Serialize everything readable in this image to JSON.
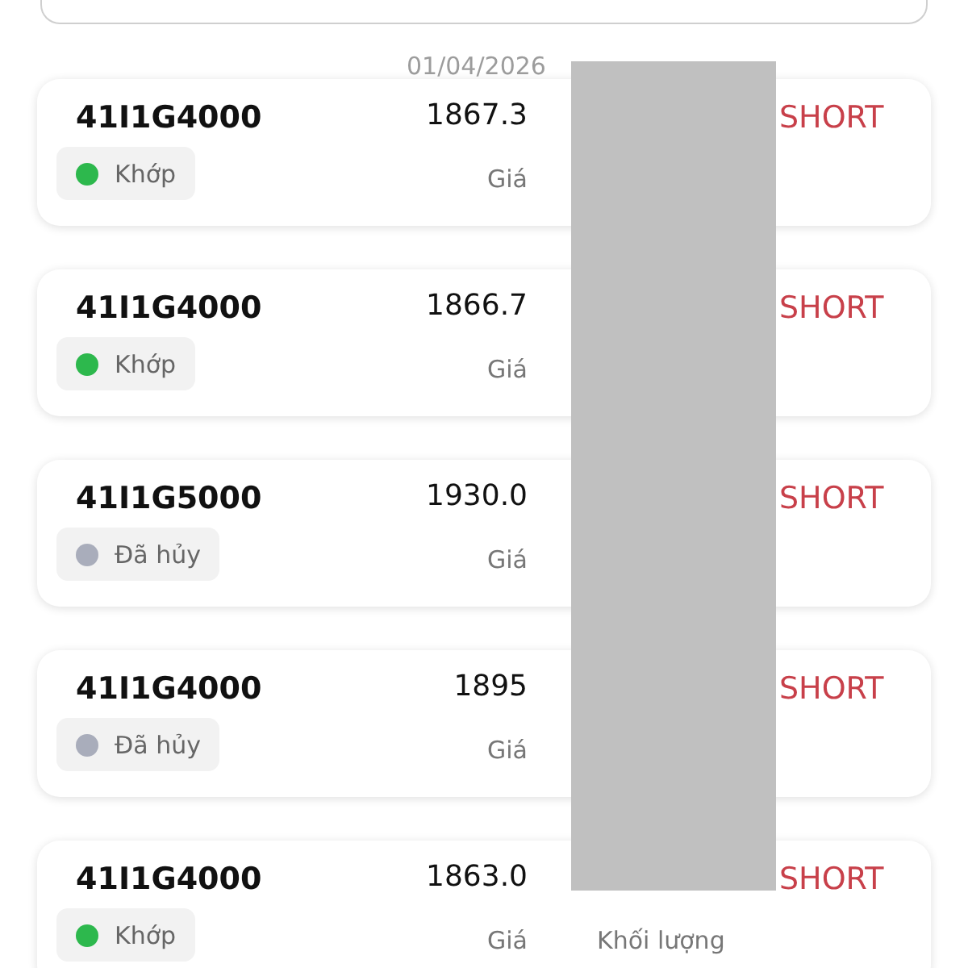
{
  "overlay_date": "01/04/2026",
  "orders": [
    {
      "code": "41I1G4000",
      "status": {
        "label": "Khớp",
        "color": "#2db84d"
      },
      "price": "1867.3",
      "price_label": "Giá",
      "side": "SHORT"
    },
    {
      "code": "41I1G4000",
      "status": {
        "label": "Khớp",
        "color": "#2db84d"
      },
      "price": "1866.7",
      "price_label": "Giá",
      "side": "SHORT"
    },
    {
      "code": "41I1G5000",
      "status": {
        "label": "Đã hủy",
        "color": "#a9adbb"
      },
      "price": "1930.0",
      "price_label": "Giá",
      "side": "SHORT"
    },
    {
      "code": "41I1G4000",
      "status": {
        "label": "Đã hủy",
        "color": "#a9adbb"
      },
      "price": "1895",
      "price_label": "Giá",
      "side": "SHORT"
    },
    {
      "code": "41I1G4000",
      "status": {
        "label": "Khớp",
        "color": "#2db84d"
      },
      "price": "1863.0",
      "price_label": "Giá",
      "volume_label": "Khối lượng",
      "side": "SHORT"
    }
  ]
}
